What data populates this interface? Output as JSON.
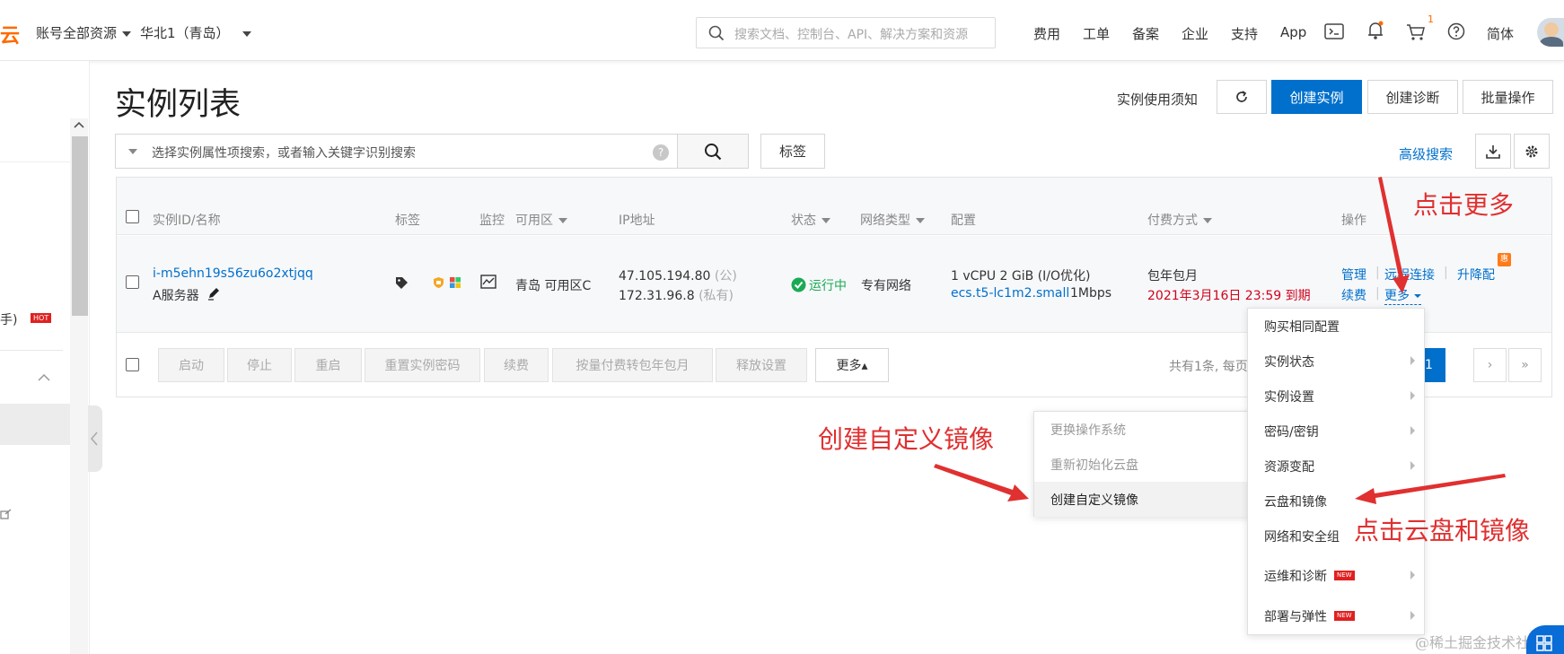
{
  "topbar": {
    "logo": "云",
    "account": "账号全部资源",
    "region": "华北1（青岛）",
    "search_placeholder": "搜索文档、控制台、API、解决方案和资源",
    "nav": [
      "费用",
      "工单",
      "备案",
      "企业",
      "支持",
      "App"
    ],
    "cart_badge": "1",
    "lang": "简体"
  },
  "sidebar": {
    "item_text": "手)",
    "hot_badge": "HOT"
  },
  "page": {
    "title": "实例列表",
    "notice_link": "实例使用须知",
    "create_instance": "创建实例",
    "create_diagnosis": "创建诊断",
    "batch_ops": "批量操作",
    "filter_placeholder": "选择实例属性项搜索，或者输入关键字识别搜索",
    "filter_help": "?",
    "tag_button": "标签",
    "advanced_search": "高级搜索"
  },
  "table": {
    "headers": {
      "id": "实例ID/名称",
      "tags": "标签",
      "monitor": "监控",
      "zone": "可用区",
      "ip": "IP地址",
      "status": "状态",
      "network": "网络类型",
      "config": "配置",
      "billing": "付费方式",
      "ops": "操作"
    },
    "rows": [
      {
        "id": "i-m5ehn19s56zu6o2xtjqq",
        "name": "A服务器",
        "zone": "青岛 可用区C",
        "ip_public": "47.105.194.80",
        "ip_public_tag": "(公)",
        "ip_private": "172.31.96.8",
        "ip_private_tag": "(私有)",
        "status": "运行中",
        "network": "专有网络",
        "config_line1": "1 vCPU 2 GiB   (I/O优化)",
        "instance_type": "ecs.t5-lc1m2.small",
        "bandwidth": "1Mbps",
        "billing": "包年包月",
        "expire": "2021年3月16日 23:59 到期",
        "ops": {
          "manage": "管理",
          "remote": "远程连接",
          "upgrade": "升降配",
          "renew": "续费",
          "more": "更多"
        },
        "promo_badge": "惠"
      }
    ]
  },
  "footer_actions": [
    "启动",
    "停止",
    "重启",
    "重置实例密码",
    "续费",
    "按量付费转包年包月",
    "释放设置"
  ],
  "footer_more": "更多▴",
  "pagination": {
    "summary": "共有1条, 每页",
    "current": "1",
    "next": "›",
    "last": "»"
  },
  "more_menu": [
    {
      "label": "购买相同配置",
      "submenu": false,
      "new": false
    },
    {
      "label": "实例状态",
      "submenu": true,
      "new": false
    },
    {
      "label": "实例设置",
      "submenu": true,
      "new": false
    },
    {
      "label": "密码/密钥",
      "submenu": true,
      "new": false
    },
    {
      "label": "资源变配",
      "submenu": true,
      "new": false
    },
    {
      "label": "云盘和镜像",
      "submenu": false,
      "new": false
    },
    {
      "label": "网络和安全组",
      "submenu": false,
      "new": false
    },
    {
      "label": "运维和诊断",
      "submenu": true,
      "new": true
    },
    {
      "label": "部署与弹性",
      "submenu": true,
      "new": true
    }
  ],
  "new_badge": "NEW",
  "submenu": [
    {
      "label": "更换操作系统",
      "disabled": true
    },
    {
      "label": "重新初始化云盘",
      "disabled": true
    },
    {
      "label": "创建自定义镜像",
      "disabled": false
    }
  ],
  "annotations": {
    "click_more": "点击更多",
    "create_image": "创建自定义镜像",
    "click_disk": "点击云盘和镜像"
  },
  "watermark": "@稀土掘金技术社区",
  "colors": {
    "primary": "#0070cc",
    "brand": "#ff6a00",
    "annotation": "#e03030",
    "running": "#1aaa55"
  }
}
